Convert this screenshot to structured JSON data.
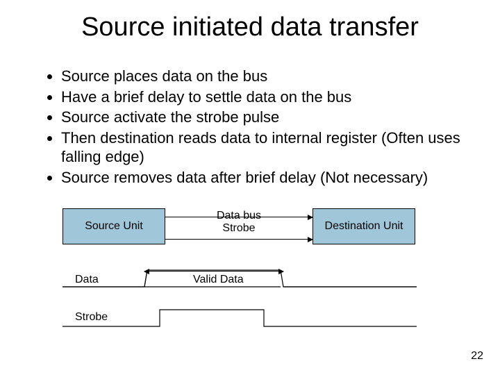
{
  "title": "Source initiated data transfer",
  "bullets": [
    "Source places data on the bus",
    "Have a brief delay to settle data on the bus",
    "Source activate the strobe pulse",
    "Then destination reads data to internal register (Often uses falling edge)",
    "Source removes data after brief delay (Not necessary)"
  ],
  "diagram": {
    "source_unit": "Source Unit",
    "destination_unit": "Destination Unit",
    "bus_label1": "Data bus",
    "bus_label2": "Strobe",
    "data_label": "Data",
    "valid_data_label": "Valid Data",
    "strobe_label": "Strobe"
  },
  "page_number": "22"
}
